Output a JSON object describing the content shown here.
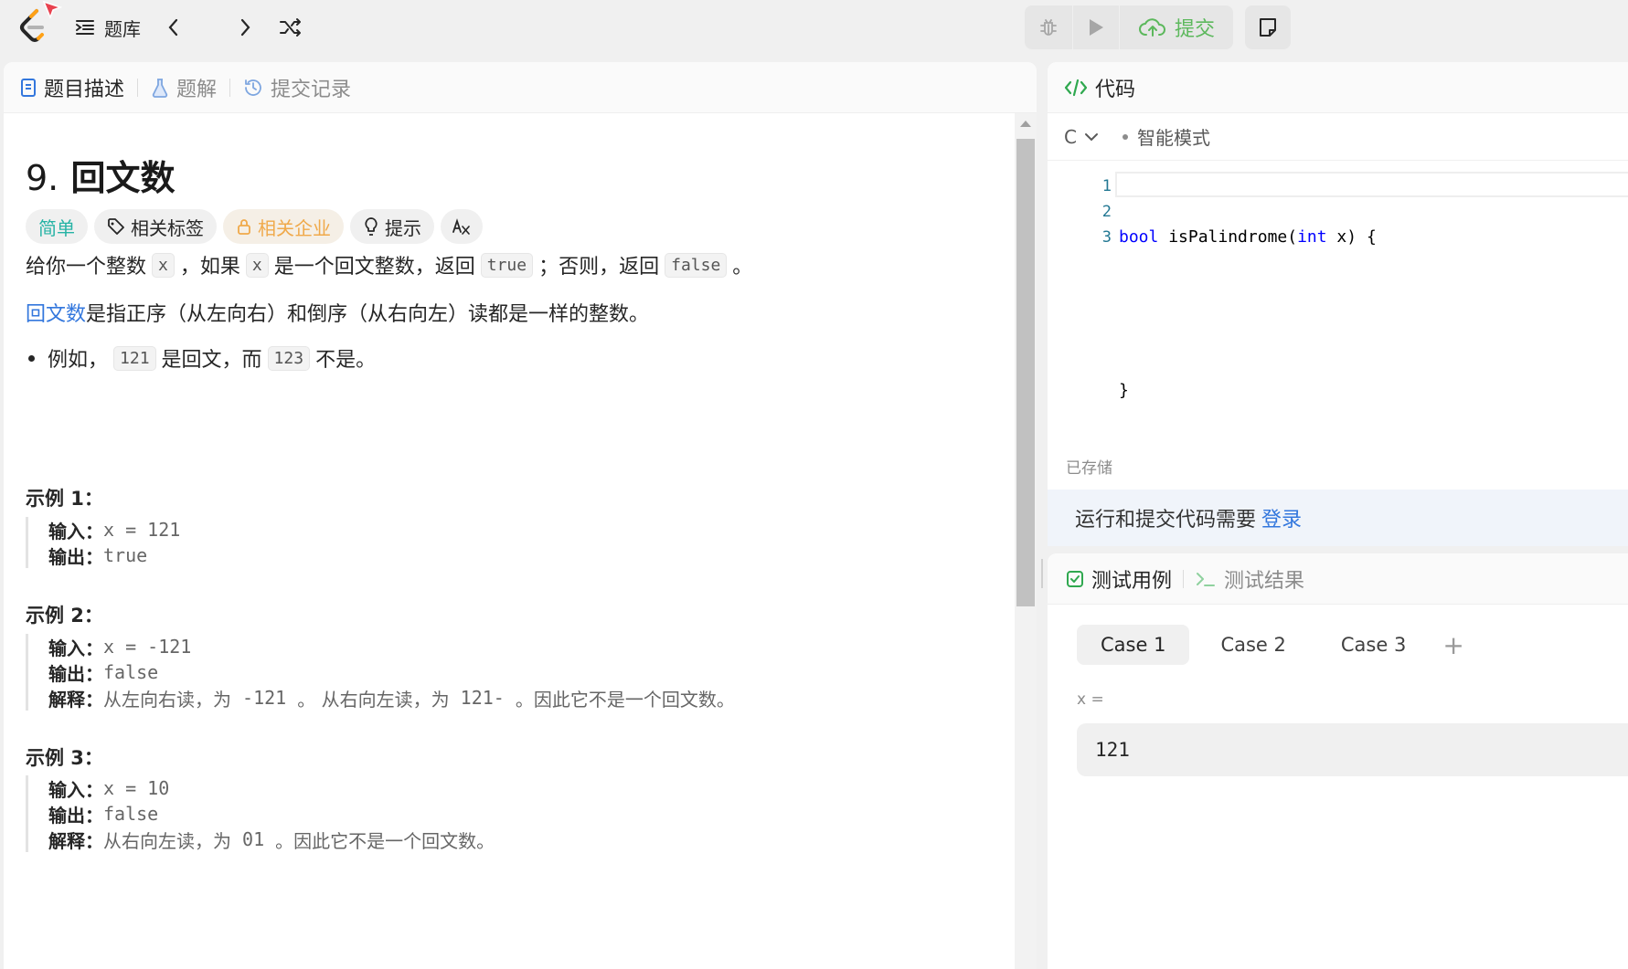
{
  "topbar": {
    "problem_list_label": "题库",
    "submit_label": "提交"
  },
  "left_tabs": [
    {
      "label": "题目描述",
      "active": true
    },
    {
      "label": "题解",
      "active": false
    },
    {
      "label": "提交记录",
      "active": false
    }
  ],
  "problem": {
    "number": "9.",
    "title": "回文数",
    "tags": {
      "difficulty": "简单",
      "related_tags": "相关标签",
      "related_companies": "相关企业",
      "hint": "提示"
    },
    "para1": {
      "a": "给你一个整数",
      "code1": "x",
      "b": "，如果",
      "code2": "x",
      "c": "是一个回文整数，返回",
      "code3": "true",
      "d": "；否则，返回",
      "code4": "false",
      "e": "。"
    },
    "para2": {
      "link": "回文数",
      "rest": "是指正序（从左向右）和倒序（从右向左）读都是一样的整数。"
    },
    "bullet": {
      "a": "例如，",
      "code1": "121",
      "b": "是回文，而",
      "code2": "123",
      "c": "不是。"
    },
    "examples": [
      {
        "title": "示例 1：",
        "input_key": "输入：",
        "input": "x = 121",
        "output_key": "输出：",
        "output": "true"
      },
      {
        "title": "示例 2：",
        "input_key": "输入：",
        "input": "x = -121",
        "output_key": "输出：",
        "output": "false",
        "explain_key": "解释：",
        "explain_a": "从左向右读，为",
        "explain_code1": " -121 ",
        "explain_b": "。 从右向左读，为",
        "explain_code2": " 121- ",
        "explain_c": "。因此它不是一个回文数。"
      },
      {
        "title": "示例 3：",
        "input_key": "输入：",
        "input": "x = 10",
        "output_key": "输出：",
        "output": "false",
        "explain_key": "解释：",
        "explain_a": "从右向左读，为",
        "explain_code1": " 01 ",
        "explain_b": "。因此它不是一个回文数。"
      }
    ]
  },
  "code_panel": {
    "title": "代码",
    "language": "C",
    "mode": "智能模式",
    "lines": [
      {
        "num": "1",
        "kw1": "bool",
        "mid": " isPalindrome(",
        "kw2": "int",
        "end": " x) {"
      },
      {
        "num": "2"
      },
      {
        "num": "3",
        "text": "}"
      }
    ],
    "saved": "已存储",
    "login_text": "运行和提交代码需要",
    "login_link": "登录"
  },
  "test_panel": {
    "tabs": [
      {
        "label": "测试用例",
        "active": true
      },
      {
        "label": "测试结果",
        "active": false
      }
    ],
    "cases": [
      "Case 1",
      "Case 2",
      "Case 3"
    ],
    "add_case": "+",
    "var_label": "x =",
    "var_value": "121"
  },
  "colors": {
    "accent_blue": "#3377dd",
    "easy_green": "#26b3a5",
    "submit_green": "#5cb85c",
    "locked_orange": "#f0a94a"
  }
}
